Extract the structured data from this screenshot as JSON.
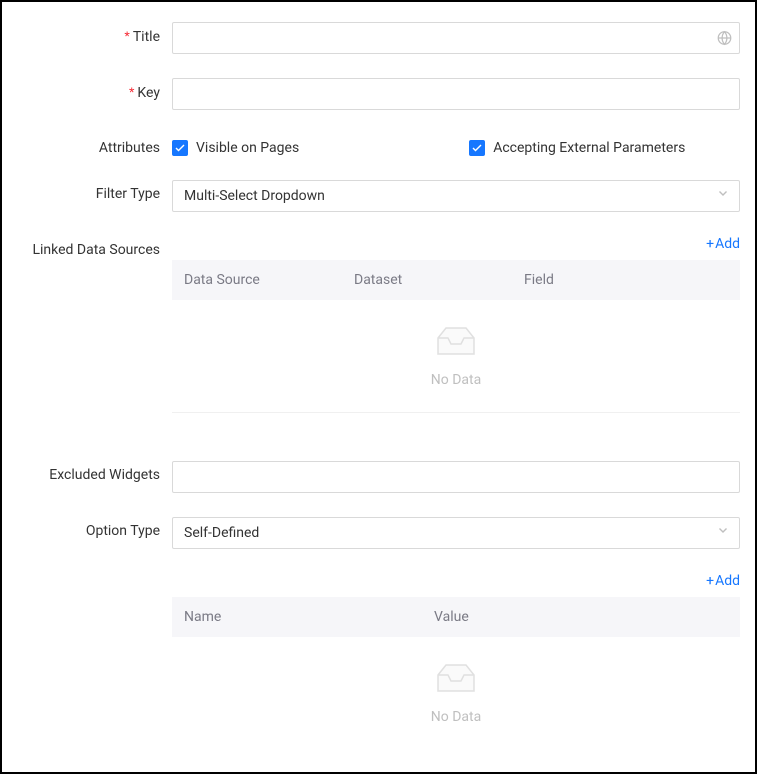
{
  "labels": {
    "title": "Title",
    "key": "Key",
    "attributes": "Attributes",
    "filterType": "Filter Type",
    "linkedDataSources": "Linked Data Sources",
    "excludedWidgets": "Excluded Widgets",
    "optionType": "Option Type"
  },
  "fields": {
    "title": "",
    "key": "",
    "excludedWidgets": ""
  },
  "checkboxes": {
    "visibleOnPages": "Visible on Pages",
    "acceptingExternalParameters": "Accepting External Parameters"
  },
  "selects": {
    "filterType": "Multi-Select Dropdown",
    "optionType": "Self-Defined"
  },
  "linkedTable": {
    "addLabel": "Add",
    "headers": {
      "dataSource": "Data Source",
      "dataset": "Dataset",
      "field": "Field"
    },
    "emptyText": "No Data"
  },
  "optionsTable": {
    "addLabel": "Add",
    "headers": {
      "name": "Name",
      "value": "Value"
    },
    "emptyText": "No Data"
  }
}
